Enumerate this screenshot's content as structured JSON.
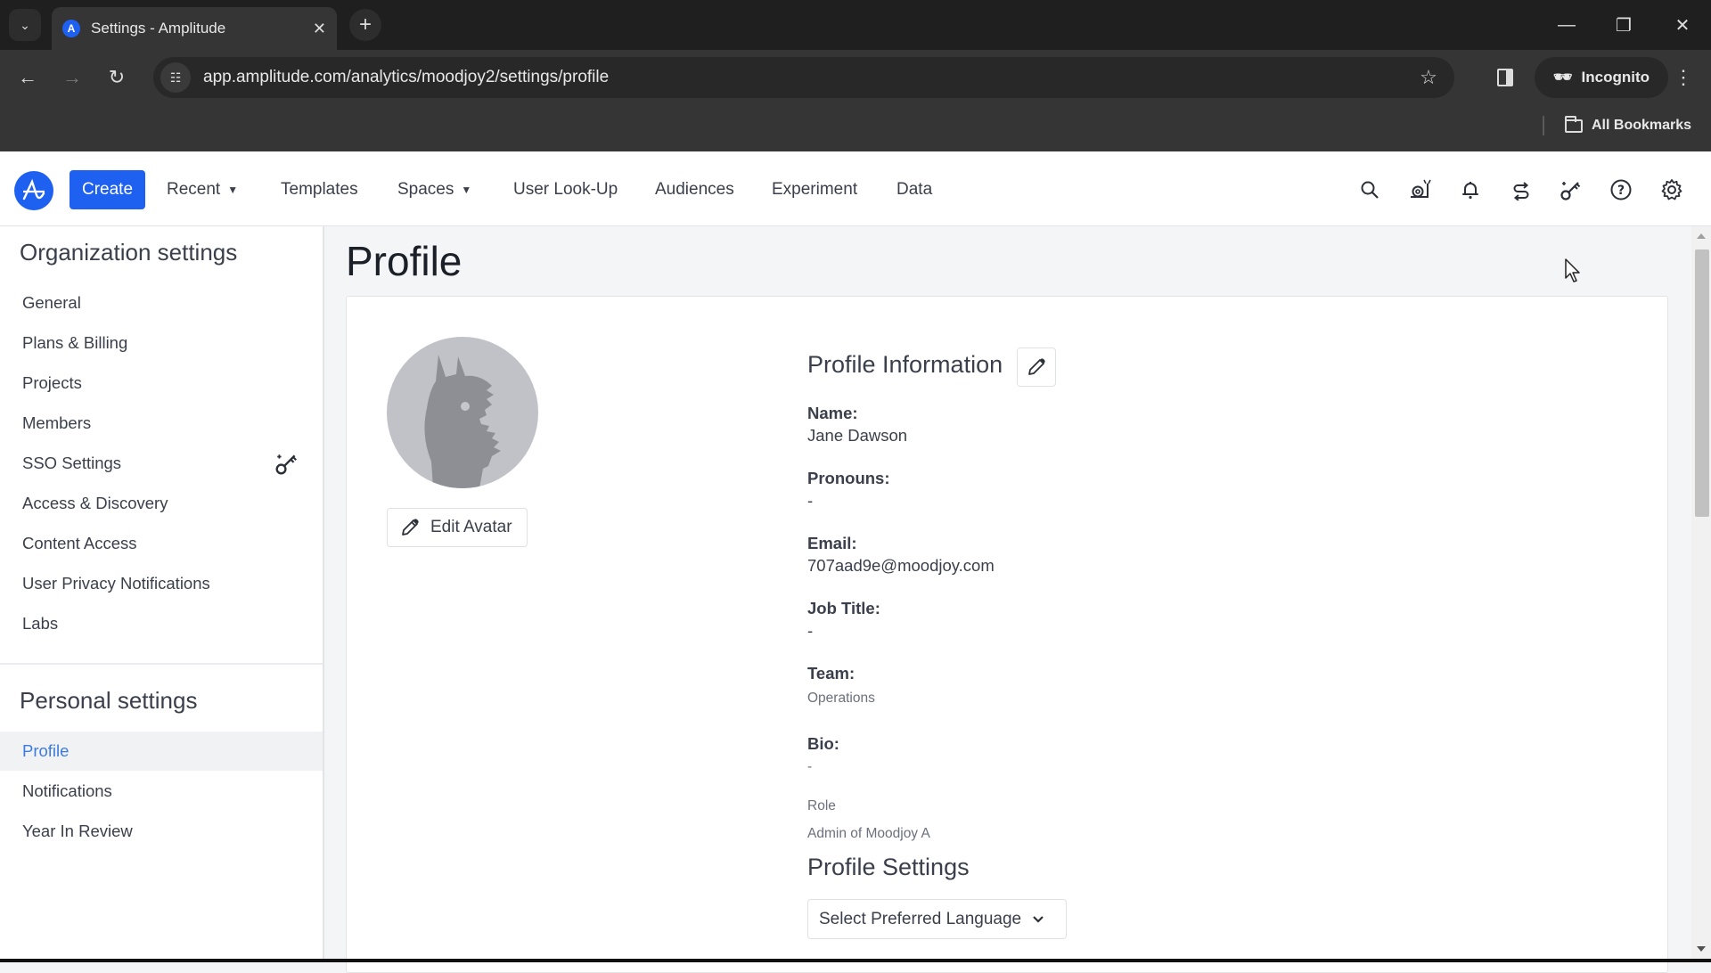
{
  "browser": {
    "tab_title": "Settings - Amplitude",
    "tab_close": "✕",
    "new_tab": "+",
    "url": "app.amplitude.com/analytics/moodjoy2/settings/profile",
    "incognito_label": "Incognito",
    "all_bookmarks_label": "All Bookmarks",
    "window_controls": {
      "minimize": "—",
      "restore": "❐",
      "close": "✕"
    }
  },
  "header": {
    "create_label": "Create",
    "nav": [
      {
        "label": "Recent",
        "dropdown": true
      },
      {
        "label": "Templates",
        "dropdown": false
      },
      {
        "label": "Spaces",
        "dropdown": true
      },
      {
        "label": "User Look-Up",
        "dropdown": false
      },
      {
        "label": "Audiences",
        "dropdown": false
      },
      {
        "label": "Experiment",
        "dropdown": false
      },
      {
        "label": "Data",
        "dropdown": false
      }
    ],
    "icons": [
      "search-icon",
      "snail-icon",
      "bell-icon",
      "sync-icon",
      "key-icon",
      "help-icon",
      "gear-icon"
    ],
    "accent_color": "#1e61f0"
  },
  "sidebar": {
    "org_heading": "Organization settings",
    "org_items": [
      {
        "label": "General"
      },
      {
        "label": "Plans & Billing"
      },
      {
        "label": "Projects"
      },
      {
        "label": "Members"
      },
      {
        "label": "SSO Settings"
      },
      {
        "label": "Access & Discovery"
      },
      {
        "label": "Content Access"
      },
      {
        "label": "User Privacy Notifications"
      },
      {
        "label": "Labs"
      }
    ],
    "personal_heading": "Personal settings",
    "personal_items": [
      {
        "label": "Profile",
        "active": true
      },
      {
        "label": "Notifications"
      },
      {
        "label": "Year In Review"
      }
    ]
  },
  "main": {
    "page_title": "Profile",
    "edit_avatar_label": "Edit Avatar",
    "profile_info_heading": "Profile Information",
    "fields": {
      "name_label": "Name:",
      "name_value": "Jane Dawson",
      "pronouns_label": "Pronouns:",
      "pronouns_value": "-",
      "email_label": "Email:",
      "email_value": "707aad9e@moodjoy.com",
      "job_label": "Job Title:",
      "job_value": "-",
      "team_label": "Team:",
      "team_value": "Operations",
      "bio_label": "Bio:",
      "bio_value": "-",
      "role_label": "Role",
      "role_value": "Admin of Moodjoy A"
    },
    "profile_settings_heading": "Profile Settings",
    "language_select_label": "Select Preferred Language"
  }
}
